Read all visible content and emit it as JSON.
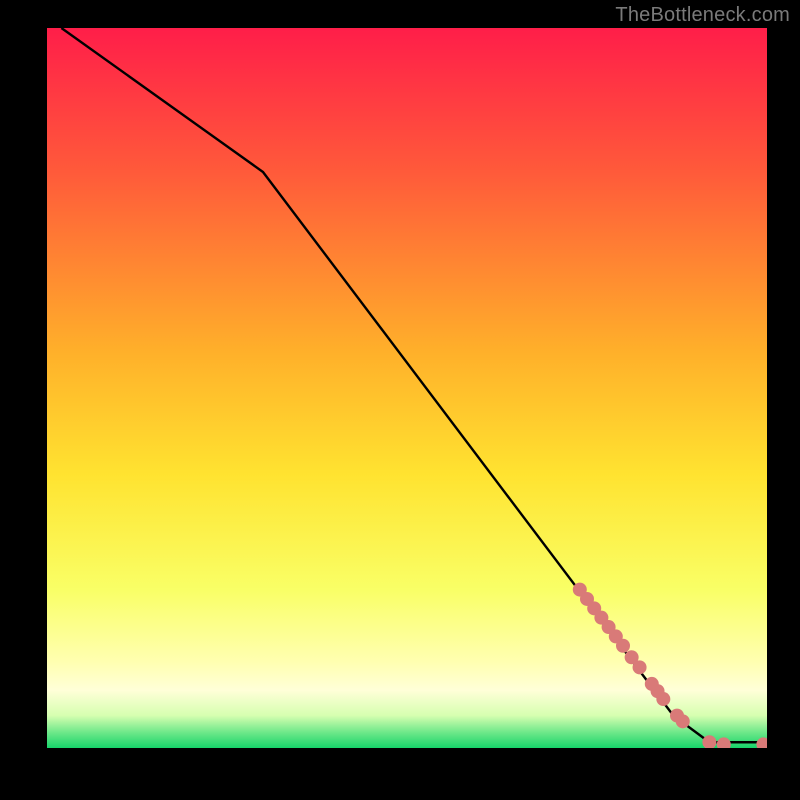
{
  "watermark": "TheBottleneck.com",
  "colors": {
    "line": "#000000",
    "marker": "#d97a78",
    "frame_bg": "#000000"
  },
  "gradient_stops": [
    {
      "offset": 0.0,
      "color": "#ff1e49"
    },
    {
      "offset": 0.2,
      "color": "#ff5a3a"
    },
    {
      "offset": 0.45,
      "color": "#ffb02a"
    },
    {
      "offset": 0.62,
      "color": "#ffe330"
    },
    {
      "offset": 0.78,
      "color": "#f9ff66"
    },
    {
      "offset": 0.88,
      "color": "#ffffb0"
    },
    {
      "offset": 0.92,
      "color": "#ffffd8"
    },
    {
      "offset": 0.955,
      "color": "#d6ffb0"
    },
    {
      "offset": 0.978,
      "color": "#6fe88a"
    },
    {
      "offset": 1.0,
      "color": "#17d46a"
    }
  ],
  "chart_data": {
    "type": "line",
    "title": "",
    "xlabel": "",
    "ylabel": "",
    "xlim": [
      0,
      100
    ],
    "ylim": [
      0,
      100
    ],
    "series": [
      {
        "name": "curve",
        "x": [
          2,
          30,
          87,
          92,
          100
        ],
        "y": [
          100,
          80,
          4.5,
          0.8,
          0.8
        ]
      }
    ],
    "markers": [
      {
        "x": 74.0,
        "y": 22.0
      },
      {
        "x": 75.0,
        "y": 20.7
      },
      {
        "x": 76.0,
        "y": 19.4
      },
      {
        "x": 77.0,
        "y": 18.1
      },
      {
        "x": 78.0,
        "y": 16.8
      },
      {
        "x": 79.0,
        "y": 15.5
      },
      {
        "x": 80.0,
        "y": 14.2
      },
      {
        "x": 81.2,
        "y": 12.6
      },
      {
        "x": 82.3,
        "y": 11.2
      },
      {
        "x": 84.0,
        "y": 8.9
      },
      {
        "x": 84.8,
        "y": 7.9
      },
      {
        "x": 85.6,
        "y": 6.8
      },
      {
        "x": 87.5,
        "y": 4.5
      },
      {
        "x": 88.3,
        "y": 3.7
      },
      {
        "x": 92.0,
        "y": 0.8
      },
      {
        "x": 94.0,
        "y": 0.5
      },
      {
        "x": 99.5,
        "y": 0.5
      }
    ],
    "marker_radius_px": 7
  }
}
